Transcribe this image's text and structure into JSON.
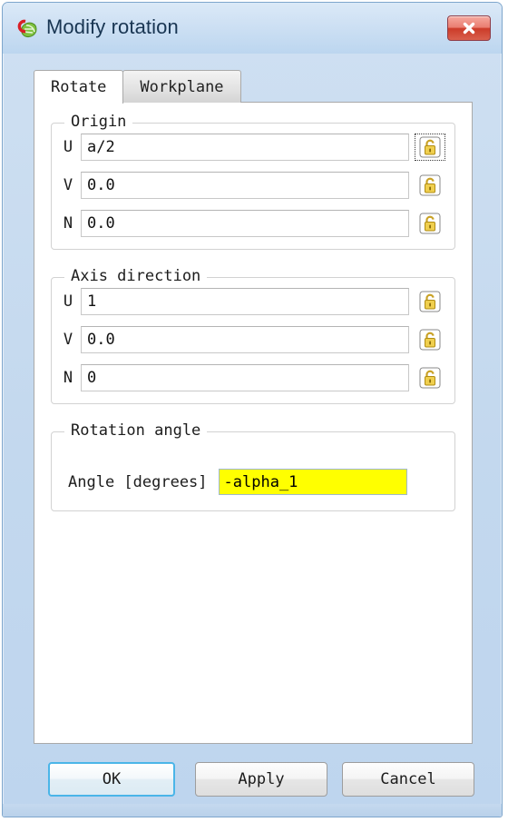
{
  "window": {
    "title": "Modify rotation",
    "app_icon": "molecule-leaf-icon",
    "close_label": "✕",
    "frame_color": "#7ea6cc",
    "titlebar_color": "#cfe1f4",
    "close_button_color": "#cc3b29"
  },
  "tabs": [
    {
      "label": "Rotate",
      "active": true
    },
    {
      "label": "Workplane",
      "active": false
    }
  ],
  "groups": {
    "origin": {
      "title": "Origin",
      "rows": [
        {
          "label": "U",
          "value": "a/2",
          "lock_icon": "open-padlock-icon",
          "lock_focused": true
        },
        {
          "label": "V",
          "value": "0.0",
          "lock_icon": "open-padlock-icon",
          "lock_focused": false
        },
        {
          "label": "N",
          "value": "0.0",
          "lock_icon": "open-padlock-icon",
          "lock_focused": false
        }
      ]
    },
    "axis_direction": {
      "title": "Axis direction",
      "rows": [
        {
          "label": "U",
          "value": "1",
          "lock_icon": "open-padlock-icon",
          "lock_focused": false
        },
        {
          "label": "V",
          "value": "0.0",
          "lock_icon": "open-padlock-icon",
          "lock_focused": false
        },
        {
          "label": "N",
          "value": "0",
          "lock_icon": "open-padlock-icon",
          "lock_focused": false
        }
      ]
    },
    "rotation_angle": {
      "title": "Rotation angle",
      "angle_label": "Angle [degrees]",
      "angle_value": "-alpha_1",
      "angle_highlight_color": "#ffff00"
    }
  },
  "buttons": {
    "ok": "OK",
    "apply": "Apply",
    "cancel": "Cancel",
    "default_button_accent": "#4ab5e8"
  }
}
